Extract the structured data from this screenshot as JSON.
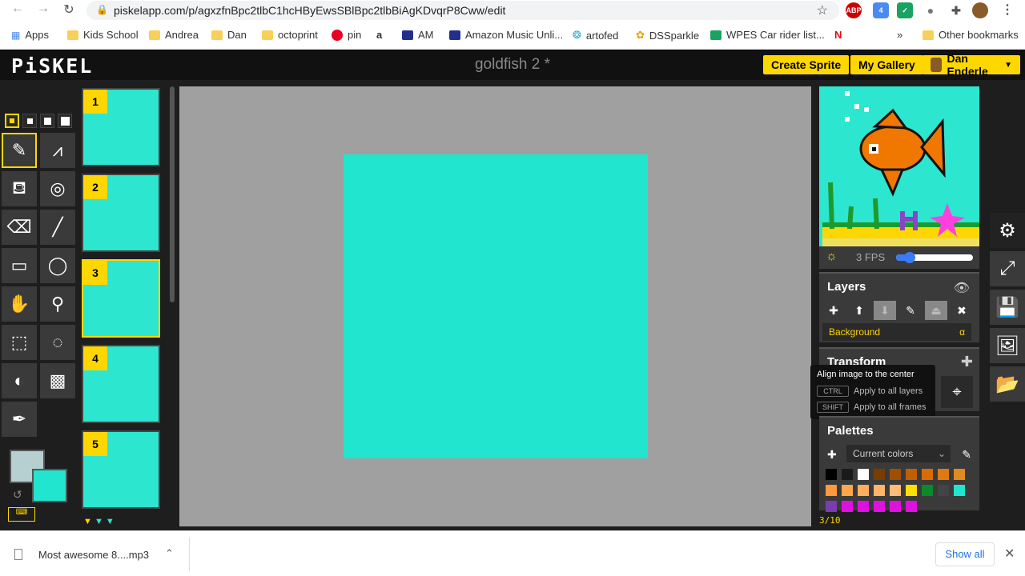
{
  "browser": {
    "url": "piskelapp.com/p/agxzfnBpc2tlbC1hcHByEwsSBlBpc2tlbBiAgKDvqrP8Cww/edit",
    "bookmarks": [
      "Apps",
      "Kids School",
      "Andrea",
      "Dan",
      "octoprint",
      "pin",
      "AM",
      "Amazon Music Unli...",
      "artofed",
      "DSSparkle",
      "WPES Car rider list...",
      "Other bookmarks"
    ],
    "more": "»"
  },
  "header": {
    "logo": "PiSKEL",
    "title": "goldfish 2 *",
    "create_sprite": "Create Sprite",
    "my_gallery": "My Gallery",
    "user": "Dan Enderle"
  },
  "frames": [
    {
      "num": "1"
    },
    {
      "num": "2"
    },
    {
      "num": "3"
    },
    {
      "num": "4"
    },
    {
      "num": "5"
    }
  ],
  "preview": {
    "fps": "3 FPS",
    "fps_value": 3
  },
  "layers": {
    "title": "Layers",
    "layer_name": "Background",
    "alpha": "α"
  },
  "transform": {
    "title": "Transform",
    "tooltip_title": "Align image to the center",
    "ctrl_key": "CTRL",
    "ctrl_desc": "Apply to all layers",
    "shift_key": "SHIFT",
    "shift_desc": "Apply to all frames"
  },
  "palettes": {
    "title": "Palettes",
    "selected": "Current colors",
    "page": "3/10",
    "colors": [
      "#000000",
      "#1a1a1a",
      "#ffffff",
      "#7a3d00",
      "#a04f00",
      "#c05f00",
      "#d86c00",
      "#e07a10",
      "#e08a20",
      "#ff9a3c",
      "#ffa64d",
      "#ffae5c",
      "#ffb46a",
      "#ffbb77",
      "#ffde00",
      "#0a8a2a",
      "#444444",
      "#22e5cf",
      "#7a3db0",
      "#e010e0",
      "#e010e0",
      "#e010e0",
      "#e010e0",
      "#e010e0"
    ]
  },
  "colors": {
    "accent": "#ffd700",
    "canvas_fill": "#22e5cf",
    "primary": "#b6cfd0",
    "secondary": "#22e5cf"
  },
  "download": {
    "file": "Most awesome 8....mp3",
    "show_all": "Show all"
  }
}
